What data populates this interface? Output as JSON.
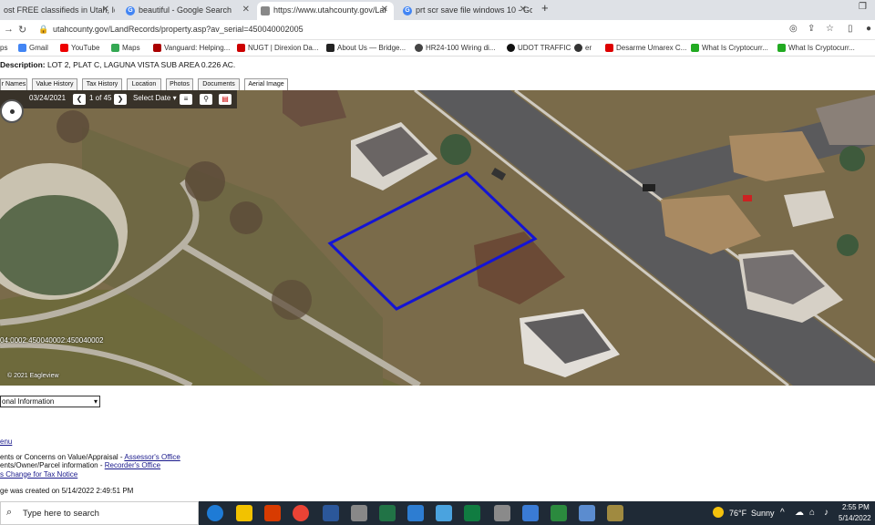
{
  "browser": {
    "tabs": [
      {
        "title": "ost FREE classifieds in Utah, Idal",
        "active": false
      },
      {
        "title": "beautiful - Google Search",
        "active": false
      },
      {
        "title": "https://www.utahcounty.gov/Lar",
        "active": true
      },
      {
        "title": "prt scr save file windows 10 - Go",
        "active": false
      }
    ],
    "new_tab_symbol": "+",
    "url": "utahcounty.gov/LandRecords/property.asp?av_serial=450040002005",
    "bookmarks": [
      {
        "label": "ps"
      },
      {
        "label": "Gmail"
      },
      {
        "label": "YouTube"
      },
      {
        "label": "Maps"
      },
      {
        "label": "Vanguard: Helping..."
      },
      {
        "label": "NUGT | Direxion Da..."
      },
      {
        "label": "About Us — Bridge..."
      },
      {
        "label": "HR24-100 Wiring di..."
      },
      {
        "label": "UDOT TRAFFIC"
      },
      {
        "label": "er"
      },
      {
        "label": "Desarme Umarex C..."
      },
      {
        "label": "What Is Cryptocurr..."
      },
      {
        "label": "What Is Cryptocurr..."
      }
    ]
  },
  "page": {
    "description_label": "Description:",
    "description_value": "LOT 2, PLAT C, LAGUNA VISTA SUB AREA 0.226 AC.",
    "tabs": [
      "r Names",
      "Value History",
      "Tax History",
      "Location",
      "Photos",
      "Documents",
      "Aerial Image"
    ],
    "active_tab": "Aerial Image",
    "map": {
      "date": "03/24/2021",
      "page_indicator": "1 of 45",
      "select_date_label": "Select Date",
      "parcel_ids": "04:0002:450040002:450040002",
      "copyright": "© 2021 Eagleview"
    },
    "dropdown_value": "onal Information",
    "links_header": "enu",
    "link_rows": [
      {
        "prefix": "ents or Concerns on Value/Appraisal - ",
        "link": "Assessor's Office"
      },
      {
        "prefix": "ents/Owner/Parcel information - ",
        "link": "Recorder's Office"
      },
      {
        "prefix": "",
        "link": "s Change for Tax Notice"
      }
    ],
    "created_text": "ge was created on 5/14/2022 2:49:51 PM"
  },
  "taskbar": {
    "search_placeholder": "Type here to search",
    "weather_temp": "76°F",
    "weather_text": "Sunny",
    "time": "2:55 PM",
    "date": "5/14/2022"
  }
}
